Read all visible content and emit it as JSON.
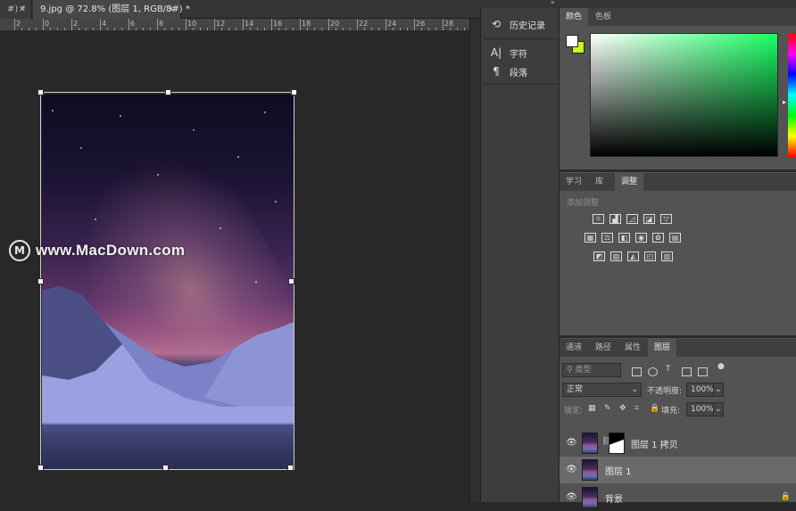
{
  "document_tabs": [
    {
      "label": "#) *",
      "close": "×"
    },
    {
      "label": "9.jpg @ 72.8% (图层 1, RGB/8#) *",
      "close": "×"
    }
  ],
  "ruler": {
    "labels": [
      "2",
      "0",
      "2",
      "4",
      "6",
      "8",
      "10",
      "12",
      "14",
      "16",
      "18",
      "20",
      "22",
      "24",
      "26",
      "28"
    ]
  },
  "watermark": {
    "logo_letter": "M",
    "text": "www.MacDown.com"
  },
  "collapse_arrows": "»",
  "mid_panel": {
    "items": [
      {
        "icon": "history-icon",
        "glyph": "⟲",
        "label": "历史记录"
      },
      {
        "icon": "character-icon",
        "glyph": "A|",
        "label": "字符"
      },
      {
        "icon": "paragraph-icon",
        "glyph": "¶",
        "label": "段落"
      }
    ]
  },
  "color_panel": {
    "tabs": [
      "颜色",
      "色板"
    ],
    "active_tab": "颜色",
    "foreground_color": "#ffffff",
    "background_color": "#c6ff1a",
    "hue_color": "#19ff63"
  },
  "adjust_panel": {
    "tabs": [
      "学习",
      "库",
      "调整"
    ],
    "active_tab": "调整",
    "add_label": "添加调整",
    "icon_rows": [
      [
        "brightness-icon",
        "levels-icon",
        "curves-icon",
        "exposure-icon",
        "vibrance-icon"
      ],
      [
        "hue-saturation-icon",
        "color-balance-icon",
        "black-white-icon",
        "photo-filter-icon",
        "channel-mixer-icon",
        "color-lookup-icon"
      ],
      [
        "invert-icon",
        "posterize-icon",
        "threshold-icon",
        "selective-color-icon",
        "gradient-map-icon"
      ]
    ],
    "icon_glyphs": [
      [
        "☼",
        "▟",
        "◿",
        "◪",
        "▽"
      ],
      [
        "▦",
        "⚖",
        "◧",
        "◉",
        "✿",
        "▤"
      ],
      [
        "◩",
        "▨",
        "◭",
        "◰",
        "▥"
      ]
    ]
  },
  "layers_panel": {
    "tabs": [
      "通道",
      "路径",
      "属性",
      "图层"
    ],
    "active_tab": "图层",
    "filter_placeholder": "类型",
    "blend_mode": "正常",
    "opacity_label": "不透明度:",
    "opacity_value": "100%",
    "lock_label": "锁定:",
    "fill_label": "填充:",
    "fill_value": "100%",
    "layers": [
      {
        "name": "图层 1 拷贝",
        "visible": true,
        "has_mask": true,
        "selected": false
      },
      {
        "name": "图层 1",
        "visible": true,
        "has_mask": false,
        "selected": true
      },
      {
        "name": "背景",
        "visible": true,
        "has_mask": false,
        "selected": false,
        "locked": true
      }
    ]
  }
}
